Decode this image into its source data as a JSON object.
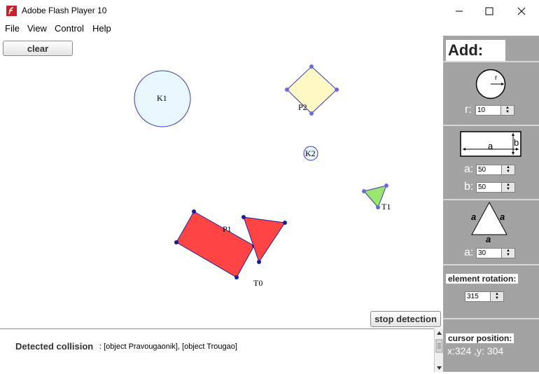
{
  "window": {
    "title": "Adobe Flash Player 10"
  },
  "menu": [
    "File",
    "View",
    "Control",
    "Help"
  ],
  "toolbar": {
    "clear_label": "clear",
    "stop_label": "stop detection"
  },
  "shapes": {
    "k1": "K1",
    "k2": "K2",
    "p1": "P1",
    "p2": "P2",
    "t0": "T0",
    "t1": "T1"
  },
  "log": {
    "label": "Detected collision",
    "text": ": [object Pravougaonik], [object Trougao]"
  },
  "sidebar": {
    "add_title": "Add:",
    "circle": {
      "radius_symbol": "r",
      "field_label": "r:",
      "value": "10"
    },
    "rect": {
      "a_symbol": "a",
      "b_symbol": "b",
      "a_label": "a:",
      "a_value": "50",
      "b_label": "b:",
      "b_value": "50"
    },
    "triangle": {
      "side_symbol": "a",
      "a_label": "a:",
      "a_value": "30"
    },
    "rotation": {
      "label": "element rotation:",
      "value": "315"
    },
    "cursor": {
      "label": "cursor position:",
      "value": "x:324 ,y: 304"
    }
  },
  "colors": {
    "sidebar_bg": "#a3a3a3",
    "collision_fill": "#ff4444",
    "app_icon": "#c8202a"
  }
}
